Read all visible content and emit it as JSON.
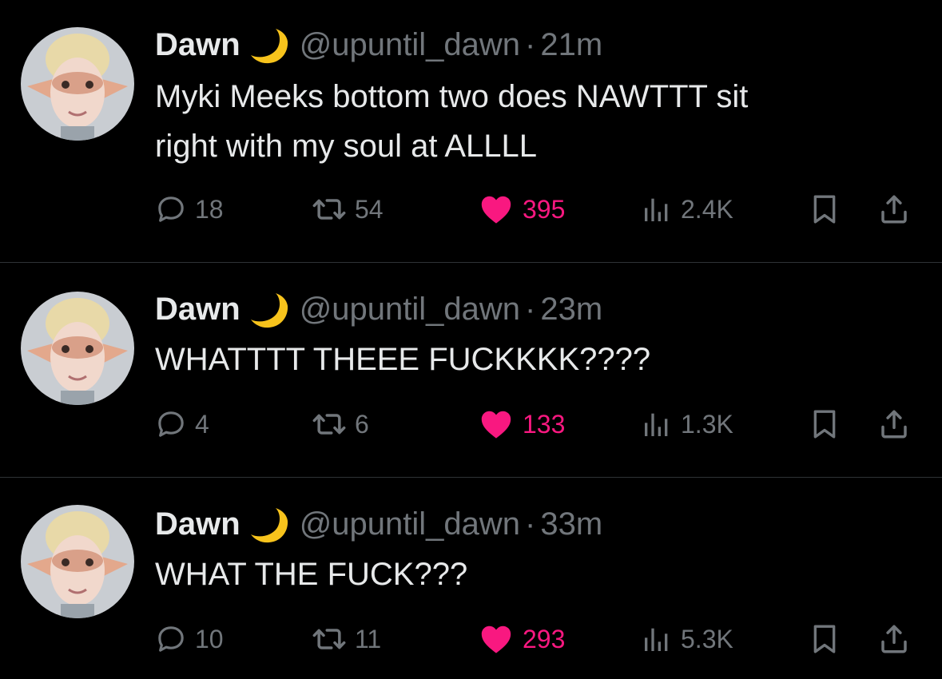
{
  "colors": {
    "background": "#000000",
    "text": "#e7e9ea",
    "muted": "#71767b",
    "like": "#f91880",
    "divider": "#2f3336"
  },
  "tweets": [
    {
      "name": "Dawn",
      "name_emoji": "crescent-moon-icon",
      "handle": "@upuntil_dawn",
      "time": "21m",
      "text_lines": [
        "Myki Meeks bottom two does NAWTTT sit",
        "right with my soul at ALLLL"
      ],
      "replies": "18",
      "retweets": "54",
      "likes": "395",
      "views": "2.4K"
    },
    {
      "name": "Dawn",
      "name_emoji": "crescent-moon-icon",
      "handle": "@upuntil_dawn",
      "time": "23m",
      "text_lines": [
        "WHATTTT THEEE FUCKKKK????"
      ],
      "replies": "4",
      "retweets": "6",
      "likes": "133",
      "views": "1.3K"
    },
    {
      "name": "Dawn",
      "name_emoji": "crescent-moon-icon",
      "handle": "@upuntil_dawn",
      "time": "33m",
      "text_lines": [
        "WHAT THE FUCK???"
      ],
      "replies": "10",
      "retweets": "11",
      "likes": "293",
      "views": "5.3K"
    }
  ],
  "dot_separator": "·"
}
